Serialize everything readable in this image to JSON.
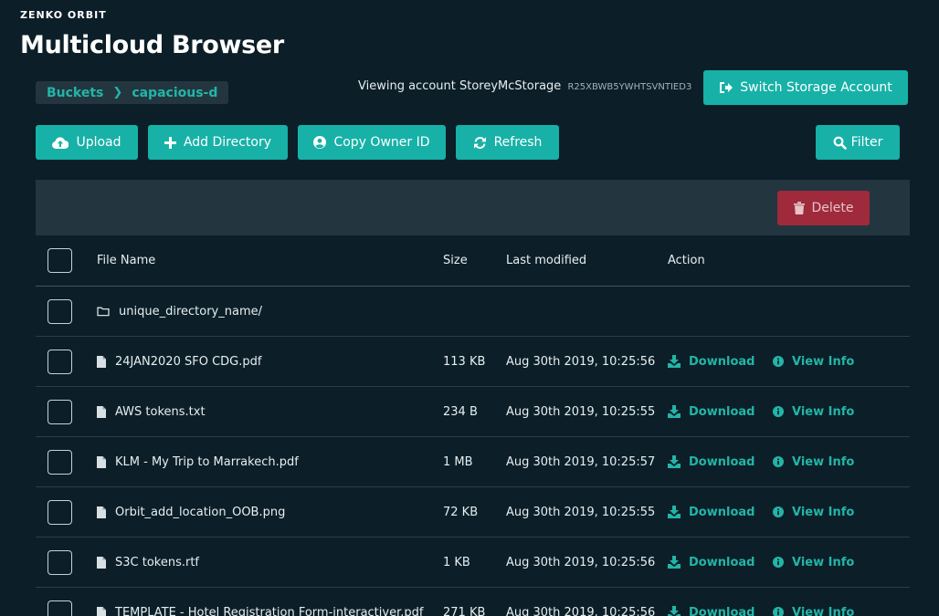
{
  "app": {
    "brand": "ZENKO ORBIT",
    "title": "Multicloud Browser"
  },
  "breadcrumb": {
    "root": "Buckets",
    "current": "capacious-d"
  },
  "account": {
    "viewing_label": "Viewing account StoreyMcStorage",
    "id": "R25XBWB5YWHTSVNTIED3"
  },
  "toolbar": {
    "switch_account": "Switch Storage Account",
    "upload": "Upload",
    "add_directory": "Add Directory",
    "copy_owner_id": "Copy Owner ID",
    "refresh": "Refresh",
    "filter": "Filter",
    "delete": "Delete"
  },
  "table": {
    "headers": {
      "name": "File Name",
      "size": "Size",
      "modified": "Last modified",
      "action": "Action"
    },
    "directory": {
      "name": "unique_directory_name/"
    },
    "rows": [
      {
        "name": "24JAN2020 SFO CDG.pdf",
        "size": "113 KB",
        "modified": "Aug 30th 2019, 10:25:56",
        "download": "Download",
        "info": "View Info"
      },
      {
        "name": "AWS tokens.txt",
        "size": "234 B",
        "modified": "Aug 30th 2019, 10:25:55",
        "download": "Download",
        "info": "View Info"
      },
      {
        "name": "KLM - My Trip to Marrakech.pdf",
        "size": "1 MB",
        "modified": "Aug 30th 2019, 10:25:57",
        "download": "Download",
        "info": "View Info"
      },
      {
        "name": "Orbit_add_location_OOB.png",
        "size": "72 KB",
        "modified": "Aug 30th 2019, 10:25:55",
        "download": "Download",
        "info": "View Info"
      },
      {
        "name": "S3C tokens.rtf",
        "size": "1 KB",
        "modified": "Aug 30th 2019, 10:25:56",
        "download": "Download",
        "info": "View Info"
      },
      {
        "name": "TEMPLATE - Hotel Registration Form-interactiver.pdf",
        "size": "271 KB",
        "modified": "Aug 30th 2019, 10:25:56",
        "download": "Download",
        "info": "View Info"
      }
    ]
  },
  "colors": {
    "accent": "#17b1a7",
    "background": "#0c1f28",
    "danger": "#9e2a3c",
    "panel": "#233640"
  }
}
